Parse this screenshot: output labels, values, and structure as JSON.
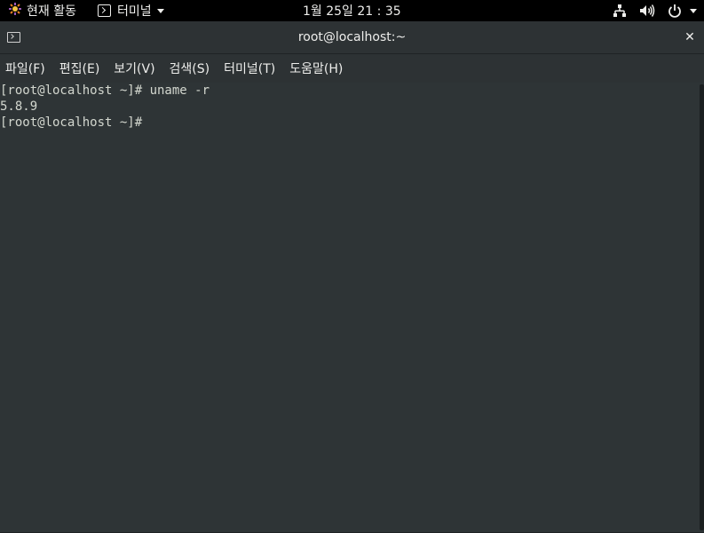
{
  "topbar": {
    "activities_label": "현재 활동",
    "app_menu_label": "터미널",
    "clock": "1월 25일  21 : 35",
    "status_icons": [
      "network-icon",
      "volume-icon",
      "power-icon",
      "chevron-down-icon"
    ]
  },
  "window": {
    "title": "root@localhost:~",
    "close_glyph": "✕"
  },
  "menubar": {
    "items": [
      "파일(F)",
      "편집(E)",
      "보기(V)",
      "검색(S)",
      "터미널(T)",
      "도움말(H)"
    ]
  },
  "terminal": {
    "lines": [
      "[root@localhost ~]# uname -r",
      "5.8.9",
      "[root@localhost ~]#"
    ]
  },
  "colors": {
    "terminal_bg": "#2e3436",
    "terminal_fg": "#d3d7cf",
    "topbar_bg": "#000000"
  }
}
